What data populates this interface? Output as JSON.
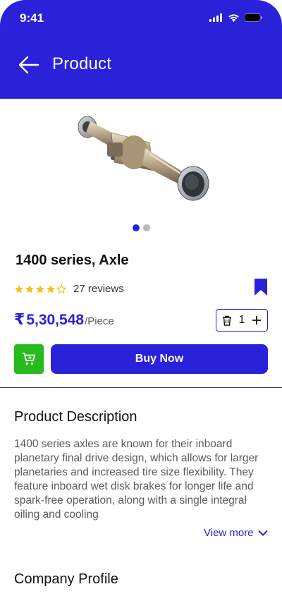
{
  "status_bar": {
    "time": "9:41"
  },
  "header": {
    "title": "Product"
  },
  "product": {
    "name": "1400 series, Axle",
    "rating": 4.5,
    "reviews": "27 reviews",
    "price_symbol": "₹",
    "price": "5,30,548",
    "price_unit": "/Piece",
    "quantity": "1",
    "image_slides": 2,
    "active_slide": 1
  },
  "actions": {
    "buy_now": "Buy Now"
  },
  "description": {
    "title": "Product Description",
    "text": "1400 series axles are known for their inboard planetary final drive design, which allows for larger planetaries and increased tire size flexibility. They feature inboard wet disk brakes for longer life and spark-free operation, along with a single integral oiling and cooling",
    "view_more": "View more"
  },
  "company": {
    "title": "Company Profile"
  },
  "colors": {
    "primary": "#2a22d9",
    "cart_green": "#27bb1b",
    "star": "#f2c31b"
  },
  "icons": [
    "back-arrow-icon",
    "bookmark-icon",
    "trash-icon",
    "plus-icon",
    "cart-icon",
    "chevron-down-icon",
    "signal-icon",
    "wifi-icon",
    "battery-icon"
  ]
}
